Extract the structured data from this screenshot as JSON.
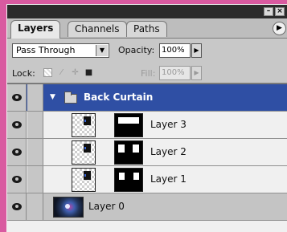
{
  "tabs": [
    {
      "label": "Layers",
      "active": true
    },
    {
      "label": "Channels",
      "active": false
    },
    {
      "label": "Paths",
      "active": false
    }
  ],
  "window_buttons": {
    "minimize": "–",
    "close": "×"
  },
  "panel_menu_arrow": "▶",
  "blend_mode": {
    "value": "Pass Through",
    "arrow": "▼"
  },
  "opacity": {
    "label": "Opacity:",
    "value": "100%",
    "arrow": "▶"
  },
  "lock": {
    "label": "Lock:",
    "icons": [
      "lock-transparent-icon",
      "lock-brush-icon",
      "lock-move-icon",
      "lock-all-icon"
    ]
  },
  "fill": {
    "label": "Fill:",
    "value": "100%",
    "arrow": "▶"
  },
  "layers": [
    {
      "name": "Back Curtain",
      "type": "group",
      "expanded_arrow": "▼",
      "selected": true
    },
    {
      "name": "Layer 3",
      "type": "layer-with-mask"
    },
    {
      "name": "Layer 2",
      "type": "layer-with-mask"
    },
    {
      "name": "Layer 1",
      "type": "layer-with-mask"
    },
    {
      "name": "Layer 0",
      "type": "image-layer"
    }
  ],
  "colors": {
    "accent": "#2f4fa4",
    "frame": "#d95aa0"
  }
}
